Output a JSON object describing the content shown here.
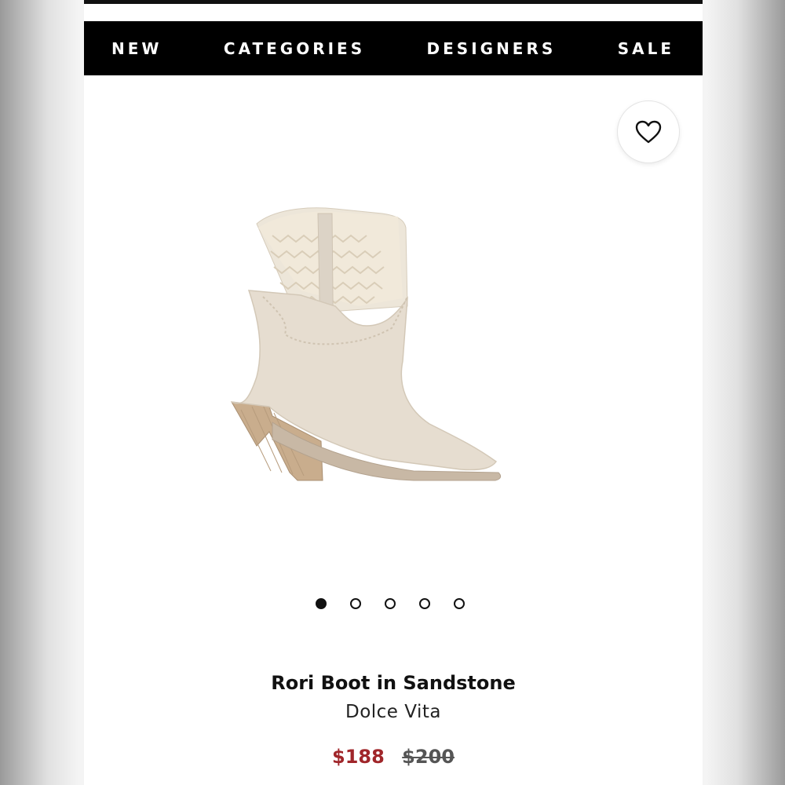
{
  "nav": {
    "items": [
      {
        "label": "NEW"
      },
      {
        "label": "CATEGORIES"
      },
      {
        "label": "DESIGNERS"
      },
      {
        "label": "SALE"
      }
    ]
  },
  "wishlist": {
    "icon": "heart-outline-icon"
  },
  "gallery": {
    "image_count": 5,
    "active_index": 0
  },
  "product": {
    "name": "Rori Boot in Sandstone",
    "brand": "Dolce Vita",
    "sale_price": "$188",
    "original_price": "$200"
  },
  "colors": {
    "nav_bg": "#000000",
    "sale_price": "#a0262a"
  }
}
